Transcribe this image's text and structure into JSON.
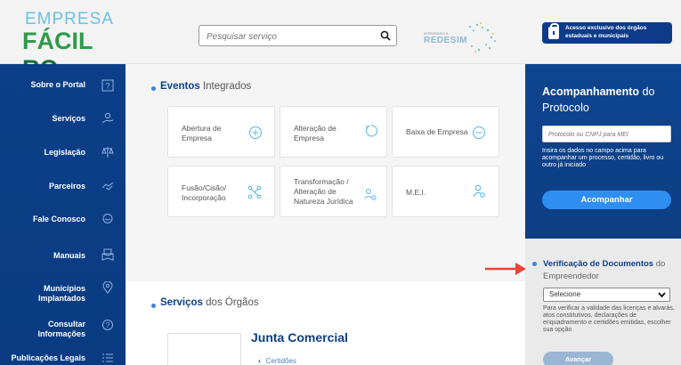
{
  "header": {
    "logo_line1": "EMPRESA",
    "logo_line2a": "FÁCIL",
    "logo_line2b": "RO",
    "search_placeholder": "Pesquisar serviço",
    "partner_small": "INTEGRADO À",
    "partner_big": "REDESIM",
    "access_text": "Acesso exclusivo dos órgãos estaduais e municipais",
    "colors": {
      "brand_blue": "#0c3f88",
      "logo_green": "#2f9a4b",
      "logo_light_blue": "#69c2e5"
    }
  },
  "sidebar": {
    "items": [
      {
        "label": "Sobre o Portal",
        "icon": "help-box-icon"
      },
      {
        "label": "Serviços",
        "icon": "user-hand-icon"
      },
      {
        "label": "Legislação",
        "icon": "scale-icon"
      },
      {
        "label": "Parceiros",
        "icon": "handshake-icon"
      },
      {
        "label": "Fale Conosco",
        "icon": "chat-icon"
      },
      {
        "label": "Manuais",
        "icon": "book-icon"
      },
      {
        "label": "Municípios\nImplantados",
        "icon": "map-pin-icon"
      },
      {
        "label": "Consultar\nInformações",
        "icon": "info-icon"
      },
      {
        "label": "Publicações Legais",
        "icon": "list-icon"
      }
    ]
  },
  "main": {
    "eventos_title_bold": "Eventos",
    "eventos_title_rest": " Integrados",
    "cards": [
      {
        "label": "Abertura de\nEmpresa",
        "icon": "plus-circle-icon"
      },
      {
        "label": "Alteração de\nEmpresa",
        "icon": "refresh-icon"
      },
      {
        "label": "Baixa de Empresa",
        "icon": "minus-circle-icon"
      },
      {
        "label": "Fusão/Cisão/\nIncorporação",
        "icon": "merge-icon"
      },
      {
        "label": "Transformação /\nAlteração de\nNatureza Jurídica",
        "icon": "people-icon"
      },
      {
        "label": "M.E.I.",
        "icon": "person-icon"
      }
    ],
    "servicos_title_bold": "Serviços",
    "servicos_title_rest": " dos Órgãos",
    "junta_title": "Junta Comercial",
    "junta_link": "Certidões"
  },
  "protocolo": {
    "title_bold": "Acompanhamento",
    "title_rest": " do Protocolo",
    "input_placeholder": "Protocolo ou CNPJ para MEI",
    "description": "Insira os dados no campo acima para acompanhar um processo, certidão, livro ou outro já iniciado",
    "button_label": "Acompanhar"
  },
  "verificacao": {
    "title_bold": "Verificação de Documentos",
    "title_rest": " do Empreendedor",
    "select_value": "Selecione",
    "description": "Para verificar a validade das licenças e alvarás, atos constitutivos, declarações de enquadramento e certidões emitidas, escolher sua opção",
    "button_label": "Avançar"
  }
}
